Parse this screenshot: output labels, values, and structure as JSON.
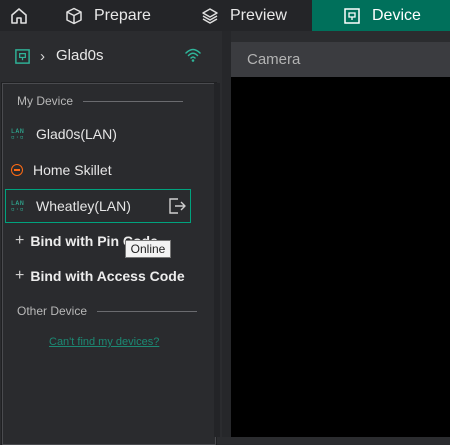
{
  "tabs": {
    "prepare": "Prepare",
    "preview": "Preview",
    "device": "Device"
  },
  "device_header": {
    "name": "Glad0s"
  },
  "device_list": {
    "my_device_label": "My Device",
    "items": [
      {
        "label": "Glad0s(LAN)",
        "icon": "lan-icon"
      },
      {
        "label": "Home Skillet",
        "icon": "offline-icon"
      },
      {
        "label": "Wheatley(LAN)",
        "icon": "lan-icon",
        "selected": true
      }
    ],
    "bind_pin": "Bind with Pin Code",
    "bind_access": "Bind with Access Code",
    "other_device_label": "Other Device",
    "cant_find": "Can't find my devices?",
    "tooltip": "Online",
    "lan_icon_text": "LAN"
  },
  "camera": {
    "title": "Camera"
  },
  "colors": {
    "accent": "#00705b",
    "link": "#1c8a74",
    "offline": "#ff6a13"
  }
}
